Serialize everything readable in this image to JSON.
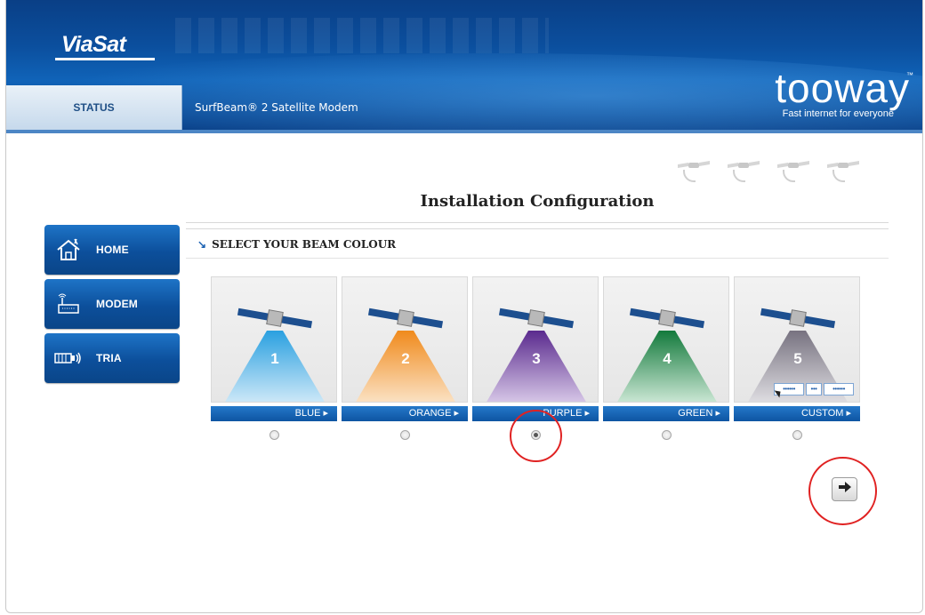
{
  "header": {
    "brand_logo_text": "ViaSat",
    "tab_status": "STATUS",
    "product_name": "SurfBeam® 2 Satellite Modem",
    "tooway_logo_text": "tooway",
    "tooway_tm": "™",
    "tooway_tagline": "Fast internet for everyone"
  },
  "page": {
    "title": "Installation Configuration",
    "section_arrow": "↘",
    "section_label": "SELECT YOUR BEAM COLOUR"
  },
  "sidebar": {
    "items": [
      {
        "label": "HOME",
        "icon": "house-icon"
      },
      {
        "label": "MODEM",
        "icon": "modem-icon"
      },
      {
        "label": "TRIA",
        "icon": "tria-icon"
      }
    ]
  },
  "beams": [
    {
      "number": "1",
      "label": "BLUE ▸",
      "color": "#35a6e0",
      "selected": false
    },
    {
      "number": "2",
      "label": "ORANGE ▸",
      "color": "#f3962a",
      "selected": false
    },
    {
      "number": "3",
      "label": "PURPLE ▸",
      "color": "#6a3a9a",
      "selected": true
    },
    {
      "number": "4",
      "label": "GREEN ▸",
      "color": "#1e8a46",
      "selected": false
    },
    {
      "number": "5",
      "label": "CUSTOM ▸",
      "color": "#7f7b84",
      "selected": false
    }
  ],
  "custom_fields": [
    "••••••",
    "•••",
    "••••••"
  ],
  "next_button_icon": "arrow-right-icon",
  "colors": {
    "brand_blue": "#0b4f9e",
    "highlight_red": "#e02121"
  }
}
